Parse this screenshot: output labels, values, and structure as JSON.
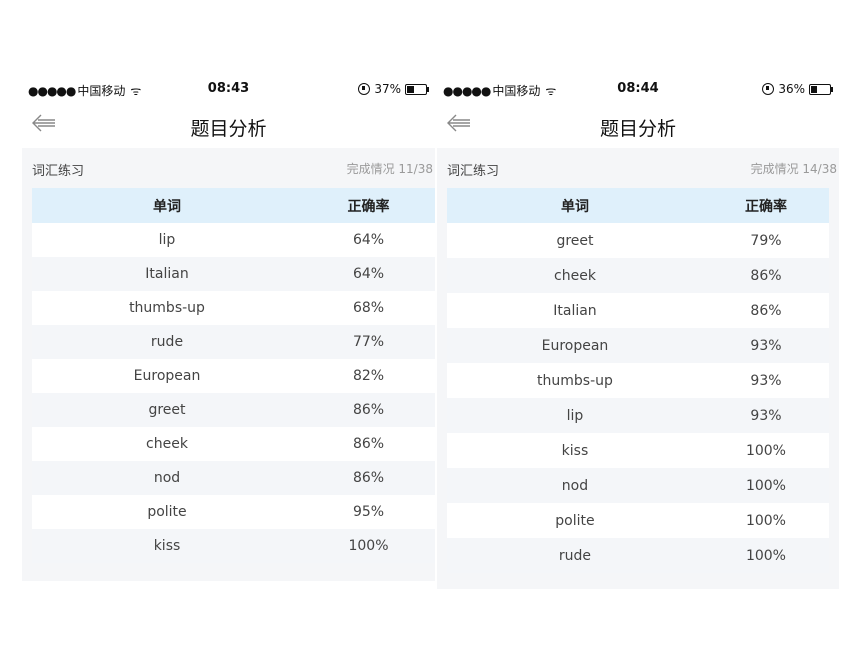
{
  "screens": [
    {
      "status": {
        "carrier": "中国移动",
        "dots": "●●●●●",
        "time": "08:43",
        "battery": "37%",
        "battery_level": 0.37
      },
      "nav": {
        "title": "题目分析",
        "back_icon": "back-arrow-icon"
      },
      "section": {
        "title": "词汇练习",
        "progress": "完成情况 11/38"
      },
      "table": {
        "headers": [
          "单词",
          "正确率"
        ],
        "rows": [
          {
            "word": "lip",
            "rate": "64%"
          },
          {
            "word": "Italian",
            "rate": "64%"
          },
          {
            "word": "thumbs-up",
            "rate": "68%"
          },
          {
            "word": "rude",
            "rate": "77%"
          },
          {
            "word": "European",
            "rate": "82%"
          },
          {
            "word": "greet",
            "rate": "86%"
          },
          {
            "word": "cheek",
            "rate": "86%"
          },
          {
            "word": "nod",
            "rate": "86%"
          },
          {
            "word": "polite",
            "rate": "95%"
          },
          {
            "word": "kiss",
            "rate": "100%"
          }
        ]
      }
    },
    {
      "status": {
        "carrier": "中国移动",
        "dots": "●●●●●",
        "time": "08:44",
        "battery": "36%",
        "battery_level": 0.36
      },
      "nav": {
        "title": "题目分析",
        "back_icon": "back-arrow-icon"
      },
      "section": {
        "title": "词汇练习",
        "progress": "完成情况 14/38"
      },
      "table": {
        "headers": [
          "单词",
          "正确率"
        ],
        "rows": [
          {
            "word": "greet",
            "rate": "79%"
          },
          {
            "word": "cheek",
            "rate": "86%"
          },
          {
            "word": "Italian",
            "rate": "86%"
          },
          {
            "word": "European",
            "rate": "93%"
          },
          {
            "word": "thumbs-up",
            "rate": "93%"
          },
          {
            "word": "lip",
            "rate": "93%"
          },
          {
            "word": "kiss",
            "rate": "100%"
          },
          {
            "word": "nod",
            "rate": "100%"
          },
          {
            "word": "polite",
            "rate": "100%"
          },
          {
            "word": "rude",
            "rate": "100%"
          }
        ]
      }
    }
  ],
  "colors": {
    "header_bg": "#dff0fb",
    "row_alt": "#f4f6f9",
    "page_bg": "#f5f6f8"
  }
}
